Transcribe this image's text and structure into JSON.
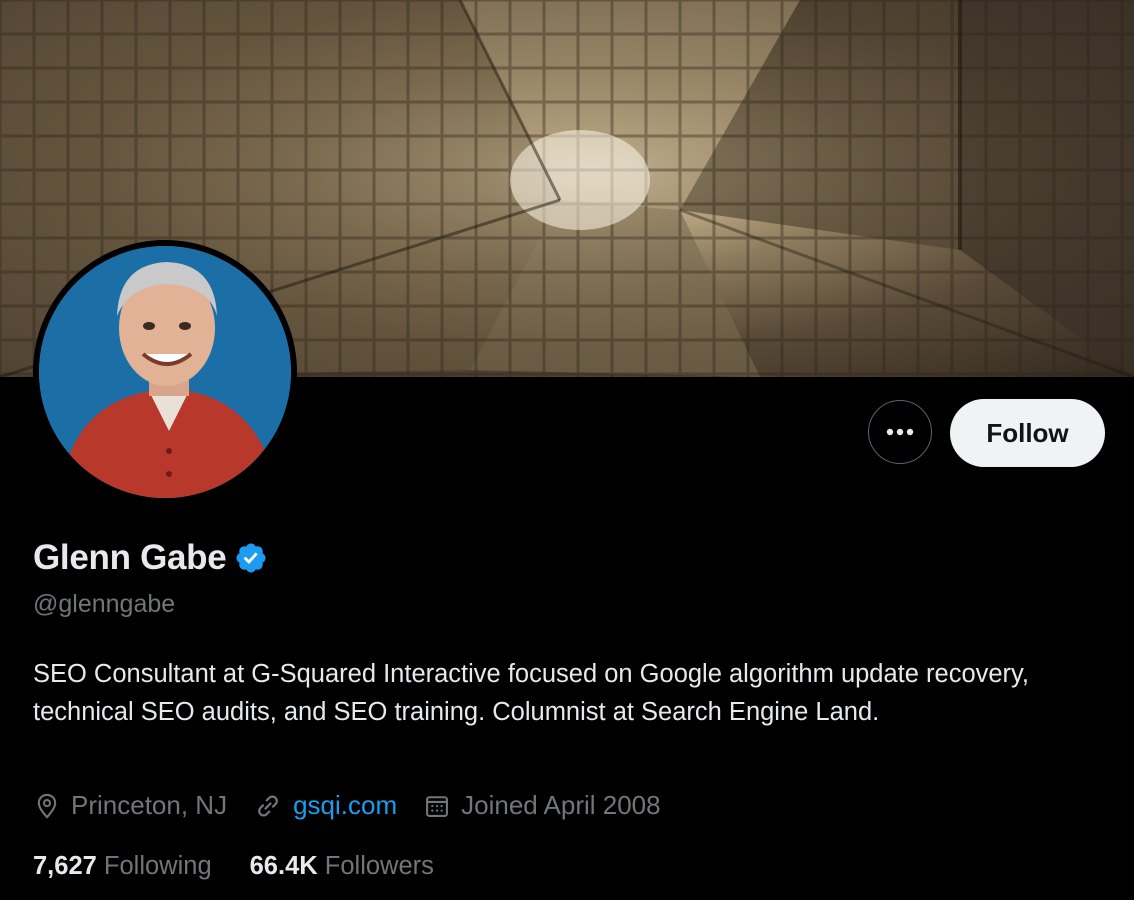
{
  "profile": {
    "name": "Glenn Gabe",
    "handle": "@glenngabe",
    "bio": "SEO Consultant at G-Squared Interactive focused on Google algorithm update recovery, technical SEO audits, and SEO training. Columnist at Search Engine Land.",
    "location": "Princeton, NJ",
    "website": "gsqi.com",
    "joined": "Joined April 2008",
    "following_count": "7,627",
    "following_label": "Following",
    "followers_count": "66.4K",
    "followers_label": "Followers",
    "verified": true
  },
  "actions": {
    "follow_label": "Follow",
    "more_icon": "ellipsis-icon"
  },
  "colors": {
    "background": "#000000",
    "accent": "#1d9bf0",
    "secondary_text": "#71767b",
    "follow_button_bg": "#eff3f4"
  }
}
